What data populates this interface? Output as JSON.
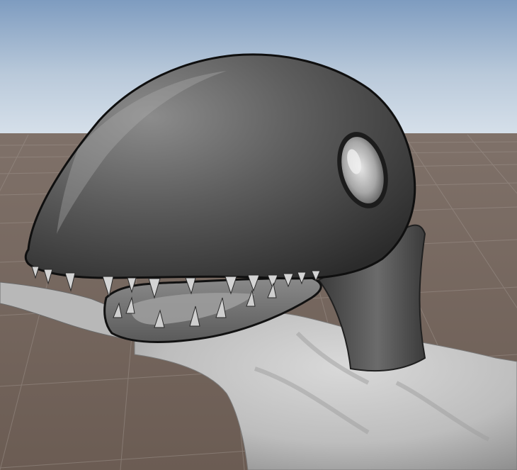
{
  "viewport": {
    "kind": "3d-scene-view",
    "colors": {
      "sky_top": "#7e9cc0",
      "sky_horizon": "#d6e0ea",
      "ground_near": "#6b5c53",
      "ground_far": "#7f7169",
      "grid_line": "#9a8f88",
      "head_dark": "#2e2e2e",
      "head_mid": "#6a6a6a",
      "head_light": "#a9a9a9",
      "body_light": "#cfcfcf",
      "body_shadow": "#8c8c8c",
      "outline": "#111111",
      "tooth": "#d2d2d2"
    }
  },
  "objects": [
    {
      "name": "ground-plane"
    },
    {
      "name": "grid-lines"
    },
    {
      "name": "creature-model",
      "parts": [
        "head",
        "eye",
        "jaw",
        "teeth",
        "neck",
        "torso",
        "arm"
      ]
    }
  ]
}
